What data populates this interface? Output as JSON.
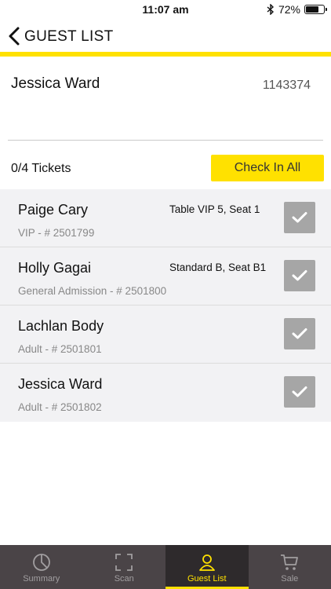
{
  "status_bar": {
    "time": "11:07 am",
    "battery": "72%",
    "battery_level": 0.72,
    "bluetooth_icon": "bluetooth-icon"
  },
  "header": {
    "title": "GUEST LIST",
    "back_icon": "chevron-left-icon"
  },
  "customer": {
    "name": "Jessica Ward",
    "id": "1143374"
  },
  "tickets": {
    "count_label": "0/4 Tickets",
    "check_in_all_label": "Check In All"
  },
  "guests": [
    {
      "name": "Paige Cary",
      "seat": "Table VIP 5, Seat 1",
      "detail": "VIP - # 2501799"
    },
    {
      "name": "Holly Gagai",
      "seat": "Standard B, Seat B1",
      "detail": "General Admission - # 2501800"
    },
    {
      "name": "Lachlan Body",
      "seat": "",
      "detail": "Adult - # 2501801"
    },
    {
      "name": "Jessica Ward",
      "seat": "",
      "detail": "Adult - # 2501802"
    }
  ],
  "tab_bar": {
    "tabs": [
      {
        "label": "Summary",
        "icon": "pie-chart-icon",
        "active": false
      },
      {
        "label": "Scan",
        "icon": "scan-frame-icon",
        "active": false
      },
      {
        "label": "Guest List",
        "icon": "person-icon",
        "active": true
      },
      {
        "label": "Sale",
        "icon": "cart-icon",
        "active": false
      }
    ]
  },
  "colors": {
    "accent": "#ffe100",
    "tab_bar_bg": "#4a4447",
    "check_button": "#a6a6a6"
  }
}
